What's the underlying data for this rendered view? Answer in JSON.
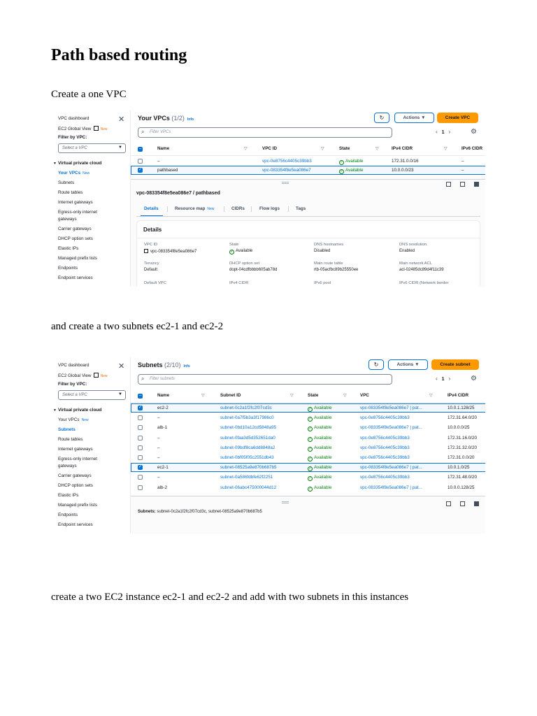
{
  "document": {
    "title": "Path based routing",
    "para1": "Create a one VPC",
    "para2": "and create a two subnets ec2-1 and ec2-2",
    "para3": "create a two EC2 instance ec2-1 and ec2-2 and add with two subnets in this instances"
  },
  "sidebar": {
    "vpc_dashboard": "VPC dashboard",
    "ec2_global_view": "EC2 Global View",
    "new_badge": "New",
    "filter_label": "Filter by VPC:",
    "filter_placeholder": "Select a VPC",
    "section": "Virtual private cloud",
    "items": [
      "Your VPCs",
      "Subnets",
      "Route tables",
      "Internet gateways",
      "Egress-only internet",
      "gateways",
      "Carrier gateways",
      "DHCP option sets",
      "Elastic IPs",
      "Managed prefix lists",
      "Endpoints",
      "Endpoint services"
    ],
    "your_vpcs_badge": "New"
  },
  "vpcs": {
    "title": "Your VPCs",
    "count": "(1/2)",
    "info": "Info",
    "actions": "Actions",
    "create": "Create VPC",
    "search_placeholder": "Filter VPCs",
    "page": "1",
    "columns": [
      "Name",
      "VPC ID",
      "State",
      "IPv4 CIDR",
      "IPv6 CIDR"
    ],
    "rows": [
      {
        "name": "–",
        "id": "vpc-0e8756c4405c39bb3",
        "state": "Available",
        "cidr": "172.31.0.0/16",
        "ipv6": "–",
        "selected": false
      },
      {
        "name": "pathbased",
        "id": "vpc-083354f8e5ea086e7",
        "state": "Available",
        "cidr": "10.0.0.0/23",
        "ipv6": "–",
        "selected": true
      }
    ],
    "detail_title": "vpc-083354f8e5ea086e7 / pathbased",
    "tabs": [
      "Details",
      "Resource map",
      "CIDRs",
      "Flow logs",
      "Tags"
    ],
    "resource_map_badge": "New",
    "details_heading": "Details",
    "fields": [
      {
        "label": "VPC ID",
        "value": "vpc-083354f8e5ea086e7",
        "kind": "copy"
      },
      {
        "label": "State",
        "value": "Available",
        "kind": "ok"
      },
      {
        "label": "DNS hostnames",
        "value": "Disabled",
        "kind": "text"
      },
      {
        "label": "DNS resolution",
        "value": "Enabled",
        "kind": "text"
      },
      {
        "label": "Tenancy",
        "value": "Default",
        "kind": "text"
      },
      {
        "label": "DHCP option set",
        "value": "dopt-04cdfbbbb605ab78d",
        "kind": "link"
      },
      {
        "label": "Main route table",
        "value": "rtb-05acfbc89b25550ee",
        "kind": "link"
      },
      {
        "label": "Main network ACL",
        "value": "acl-02485dc89d4f11c39",
        "kind": "link"
      },
      {
        "label": "Default VPC",
        "value": "",
        "kind": "text"
      },
      {
        "label": "IPv4 CIDR",
        "value": "",
        "kind": "text"
      },
      {
        "label": "IPv6 pool",
        "value": "",
        "kind": "text"
      },
      {
        "label": "IPv6 CIDR (Network border",
        "value": "",
        "kind": "text"
      }
    ]
  },
  "subnets": {
    "title": "Subnets",
    "count": "(2/10)",
    "info": "Info",
    "actions": "Actions",
    "create": "Create subnet",
    "search_placeholder": "Filter subnets",
    "page": "1",
    "columns": [
      "Name",
      "Subnet ID",
      "State",
      "VPC",
      "IPv4 CIDR"
    ],
    "rows": [
      {
        "name": "ec2-2",
        "id": "subnet-0c2a1f2fc2f07cd3c",
        "state": "Available",
        "vpc": "vpc-083354f8e5ea086e7 | pat...",
        "cidr": "10.0.1.128/25",
        "selected": true
      },
      {
        "name": "–",
        "id": "subnet-0a7f5b3a3f17986c0",
        "state": "Available",
        "vpc": "vpc-0e8756c4405c39bb3",
        "cidr": "172.31.64.0/20",
        "selected": false
      },
      {
        "name": "alb-1",
        "id": "subnet-0bd10a12cd5848a95",
        "state": "Available",
        "vpc": "vpc-083354f8e5ea086e7 | pat...",
        "cidr": "10.0.0.0/25",
        "selected": false
      },
      {
        "name": "–",
        "id": "subnet-0faa3d5d352651da0",
        "state": "Available",
        "vpc": "vpc-0e8756c4405c39bb3",
        "cidr": "172.31.16.0/20",
        "selected": false
      },
      {
        "name": "–",
        "id": "subnet-09bdf8ca6dd8848a2",
        "state": "Available",
        "vpc": "vpc-0e8756c4405c39bb3",
        "cidr": "172.31.32.0/20",
        "selected": false
      },
      {
        "name": "–",
        "id": "subnet-0bf05f05c2551db43",
        "state": "Available",
        "vpc": "vpc-0e8756c4405c39bb3",
        "cidr": "172.31.0.0/20",
        "selected": false
      },
      {
        "name": "ec2-1",
        "id": "subnet-08525a9e870b687b5",
        "state": "Available",
        "vpc": "vpc-083354f8e5ea086e7 | pat...",
        "cidr": "10.0.1.0/25",
        "selected": true
      },
      {
        "name": "–",
        "id": "subnet-0a586fdbfe62f2251",
        "state": "Available",
        "vpc": "vpc-0e8756c4405c39bb3",
        "cidr": "172.31.48.0/20",
        "selected": false
      },
      {
        "name": "alb-2",
        "id": "subnet-06abc475000044d12",
        "state": "Available",
        "vpc": "vpc-083354f8e5ea086e7 | pat...",
        "cidr": "10.0.0.128/25",
        "selected": false
      }
    ],
    "footer_label": "Subnets:",
    "footer_value": "subnet-0c2a1f2fc2f07cd3c, subnet-08525a9e870b687b5"
  }
}
